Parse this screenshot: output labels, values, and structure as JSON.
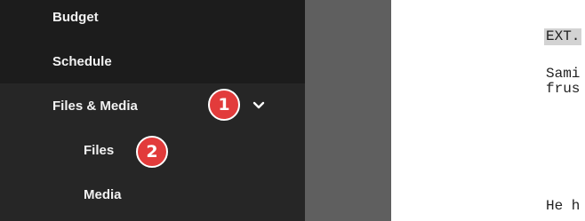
{
  "sidebar": {
    "items": [
      {
        "label": "Budget"
      },
      {
        "label": "Schedule"
      },
      {
        "label": "Files & Media",
        "expanded": true,
        "icon": "chevron-down-icon"
      }
    ],
    "subitems": [
      {
        "label": "Files"
      },
      {
        "label": "Media"
      }
    ]
  },
  "badges": [
    {
      "number": "1"
    },
    {
      "number": "2"
    }
  ],
  "colors": {
    "sidebar_bg": "#1c1c1c",
    "submenu_bg": "#262626",
    "badge": "#e23b3b",
    "gutter": "#5f5f5f",
    "page": "#ffffff",
    "scene_heading_highlight": "#d3d3d3"
  },
  "script": {
    "scene_heading": "EXT.",
    "line1": "Sami",
    "line2": "frus",
    "line3": "He h"
  }
}
